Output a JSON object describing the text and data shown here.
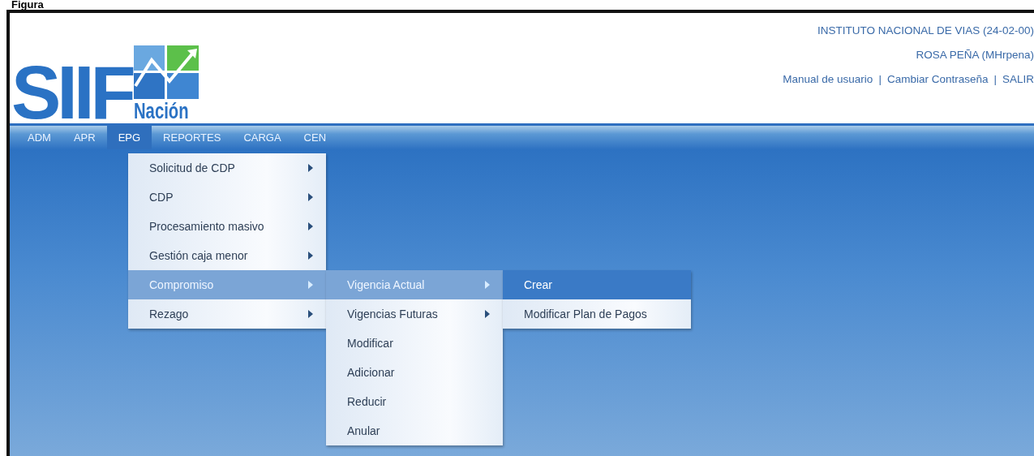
{
  "caption": "Figura",
  "header": {
    "logo_main": "SIIF",
    "logo_sub": "Nación",
    "entity": "INSTITUTO NACIONAL DE VIAS (24-02-00)",
    "user": "ROSA PEÑA (MHrpena)",
    "links": [
      "Manual de usuario",
      "Cambiar Contraseña",
      "SALIR"
    ],
    "separator": "|"
  },
  "menu_bar": [
    {
      "label": "ADM",
      "selected": false
    },
    {
      "label": "APR",
      "selected": false
    },
    {
      "label": "EPG",
      "selected": true,
      "children": [
        {
          "label": "Solicitud de CDP",
          "submenu": true,
          "selected": false
        },
        {
          "label": "CDP",
          "submenu": true,
          "selected": false
        },
        {
          "label": "Procesamiento masivo",
          "submenu": true,
          "selected": false
        },
        {
          "label": "Gestión caja menor",
          "submenu": true,
          "selected": false
        },
        {
          "label": "Compromiso",
          "submenu": true,
          "selected": true,
          "children": [
            {
              "label": "Vigencia Actual",
              "submenu": true,
              "selected": true,
              "children": [
                {
                  "label": "Crear",
                  "submenu": false,
                  "selected": true
                },
                {
                  "label": "Modificar Plan de Pagos",
                  "submenu": false,
                  "selected": false
                }
              ]
            },
            {
              "label": "Vigencias Futuras",
              "submenu": true,
              "selected": false
            },
            {
              "label": "Modificar",
              "submenu": false,
              "selected": false
            },
            {
              "label": "Adicionar",
              "submenu": false,
              "selected": false
            },
            {
              "label": "Reducir",
              "submenu": false,
              "selected": false
            },
            {
              "label": "Anular",
              "submenu": false,
              "selected": false
            }
          ]
        },
        {
          "label": "Rezago",
          "submenu": true,
          "selected": false
        }
      ]
    },
    {
      "label": "REPORTES",
      "selected": false
    },
    {
      "label": "CARGA",
      "selected": false
    },
    {
      "label": "CEN",
      "selected": false
    }
  ]
}
